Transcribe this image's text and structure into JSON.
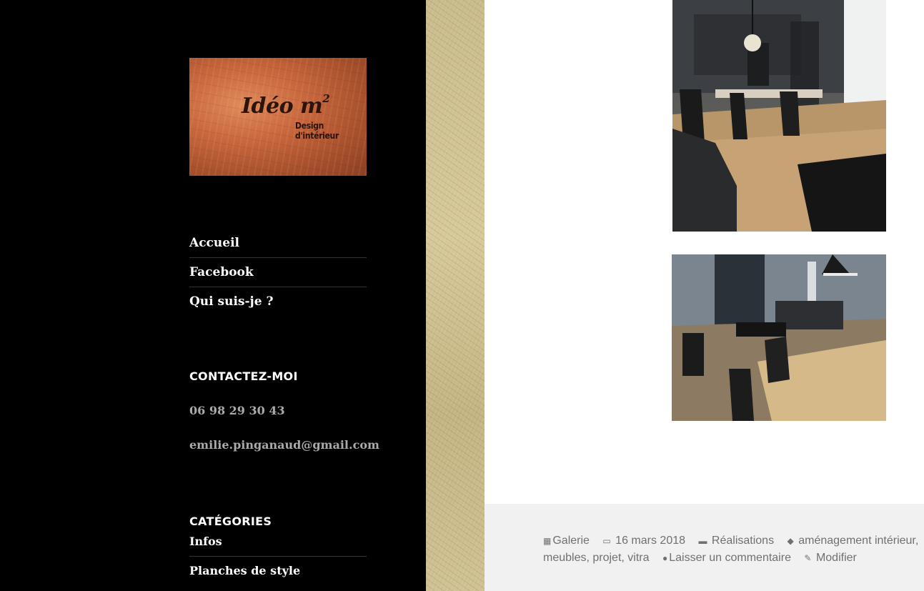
{
  "sidebar": {
    "logo": {
      "brand": "Idéo m",
      "brand_sup": "2",
      "tagline": "Design d'intérieur"
    },
    "nav": [
      {
        "label": "Accueil"
      },
      {
        "label": "Facebook"
      },
      {
        "label": "Qui suis-je ?"
      }
    ],
    "contact": {
      "title": "CONTACTEZ-MOI",
      "phone": "06 98 29 30 43",
      "email": "emilie.pinganaud@gmail.com"
    },
    "categories": {
      "title": "CATÉGORIES",
      "items": [
        {
          "label": "Infos"
        },
        {
          "label": "Planches de style"
        }
      ]
    }
  },
  "footer": {
    "format": "Galerie",
    "date": "16 mars 2018",
    "category": "Réalisations",
    "tags_line1": "aménagement intérieur,",
    "tags_line2": "meubles, projet, vitra",
    "comment": "Laisser un commentaire",
    "edit": "Modifier"
  }
}
